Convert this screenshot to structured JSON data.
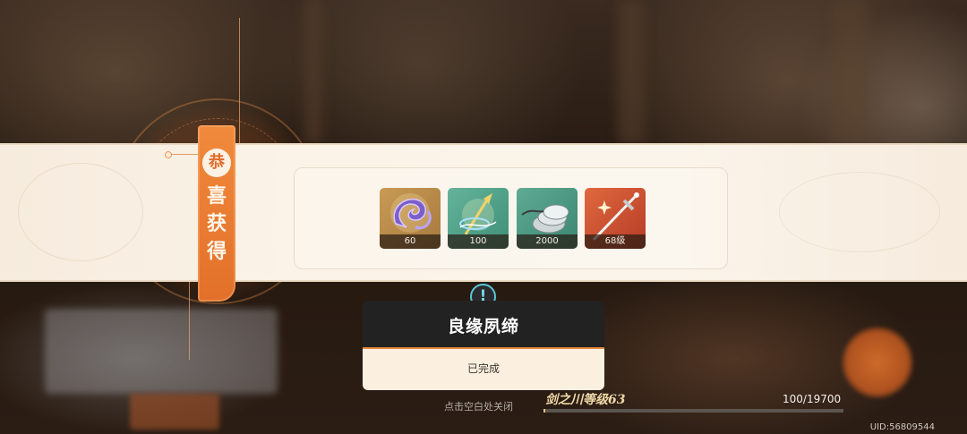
{
  "banner": {
    "badge_char": "恭",
    "title_chars": [
      "喜",
      "获",
      "得"
    ]
  },
  "rewards": [
    {
      "icon": "purple-swirl-material-icon",
      "count": "60"
    },
    {
      "icon": "golden-trident-material-icon",
      "count": "100"
    },
    {
      "icon": "silver-coins-icon",
      "count": "2000"
    },
    {
      "icon": "sword-weapon-icon",
      "count": "68级"
    }
  ],
  "quest": {
    "title": "良缘夙缔",
    "status": "已完成"
  },
  "footer": {
    "hint": "点击空白处关闭",
    "level_label": "剑之川等级63",
    "xp_text": "100/19700",
    "xp_progress": 0.005,
    "uid": "UID:56809544"
  },
  "colors": {
    "accent_orange": "#e3702a",
    "info_cyan": "#59c6d8",
    "quest_dark": "#232223"
  }
}
